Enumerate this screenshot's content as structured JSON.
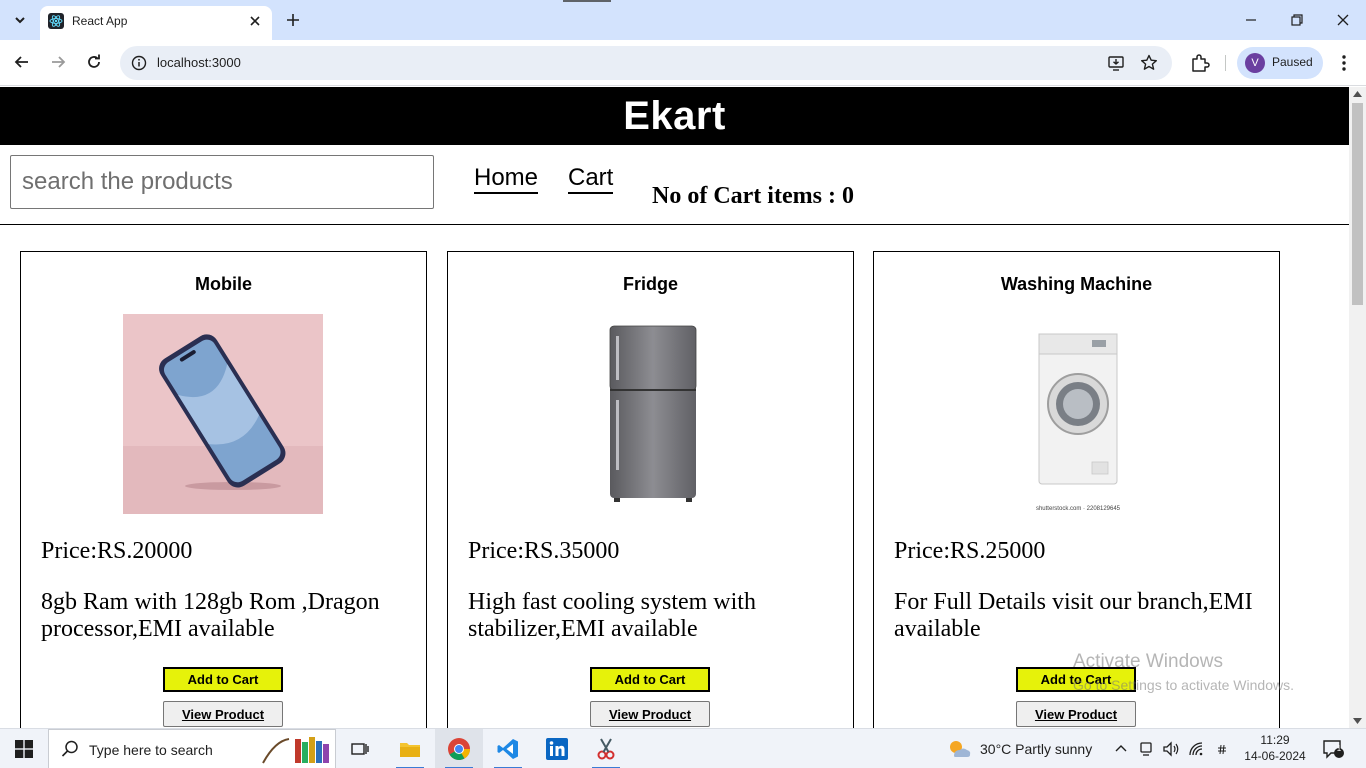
{
  "browser": {
    "tab_title": "React App",
    "url": "localhost:3000",
    "profile_initial": "V",
    "profile_status": "Paused"
  },
  "app": {
    "title": "Ekart",
    "search_placeholder": "search the products",
    "nav": {
      "home": "Home",
      "cart": "Cart"
    },
    "cart_count_text": "No of Cart items : 0"
  },
  "products": [
    {
      "name": "Mobile",
      "price": "Price:RS.20000",
      "description": "8gb Ram with 128gb Rom ,Dragon processor,EMI available",
      "add_label": "Add to Cart",
      "view_label": "View Product",
      "image_icon": "smartphone-image"
    },
    {
      "name": "Fridge",
      "price": "Price:RS.35000",
      "description": "High fast cooling system with stabilizer,EMI available",
      "add_label": "Add to Cart",
      "view_label": "View Product",
      "image_icon": "refrigerator-image"
    },
    {
      "name": "Washing Machine",
      "price": "Price:RS.25000",
      "description": "For Full Details visit our branch,EMI available",
      "add_label": "Add to Cart",
      "view_label": "View Product",
      "image_icon": "washing-machine-image",
      "image_caption": "shutterstock.com · 2208129645"
    }
  ],
  "watermark": {
    "line1": "Activate Windows",
    "line2": "Go to Settings to activate Windows."
  },
  "taskbar": {
    "search_placeholder": "Type here to search",
    "weather": "30°C  Partly sunny",
    "time": "11:29",
    "date": "14-06-2024",
    "notification_count": "1"
  },
  "colors": {
    "header_bg": "#000000",
    "add_button_bg": "#e6f20a",
    "chrome_titlebar": "#d3e3fd"
  }
}
